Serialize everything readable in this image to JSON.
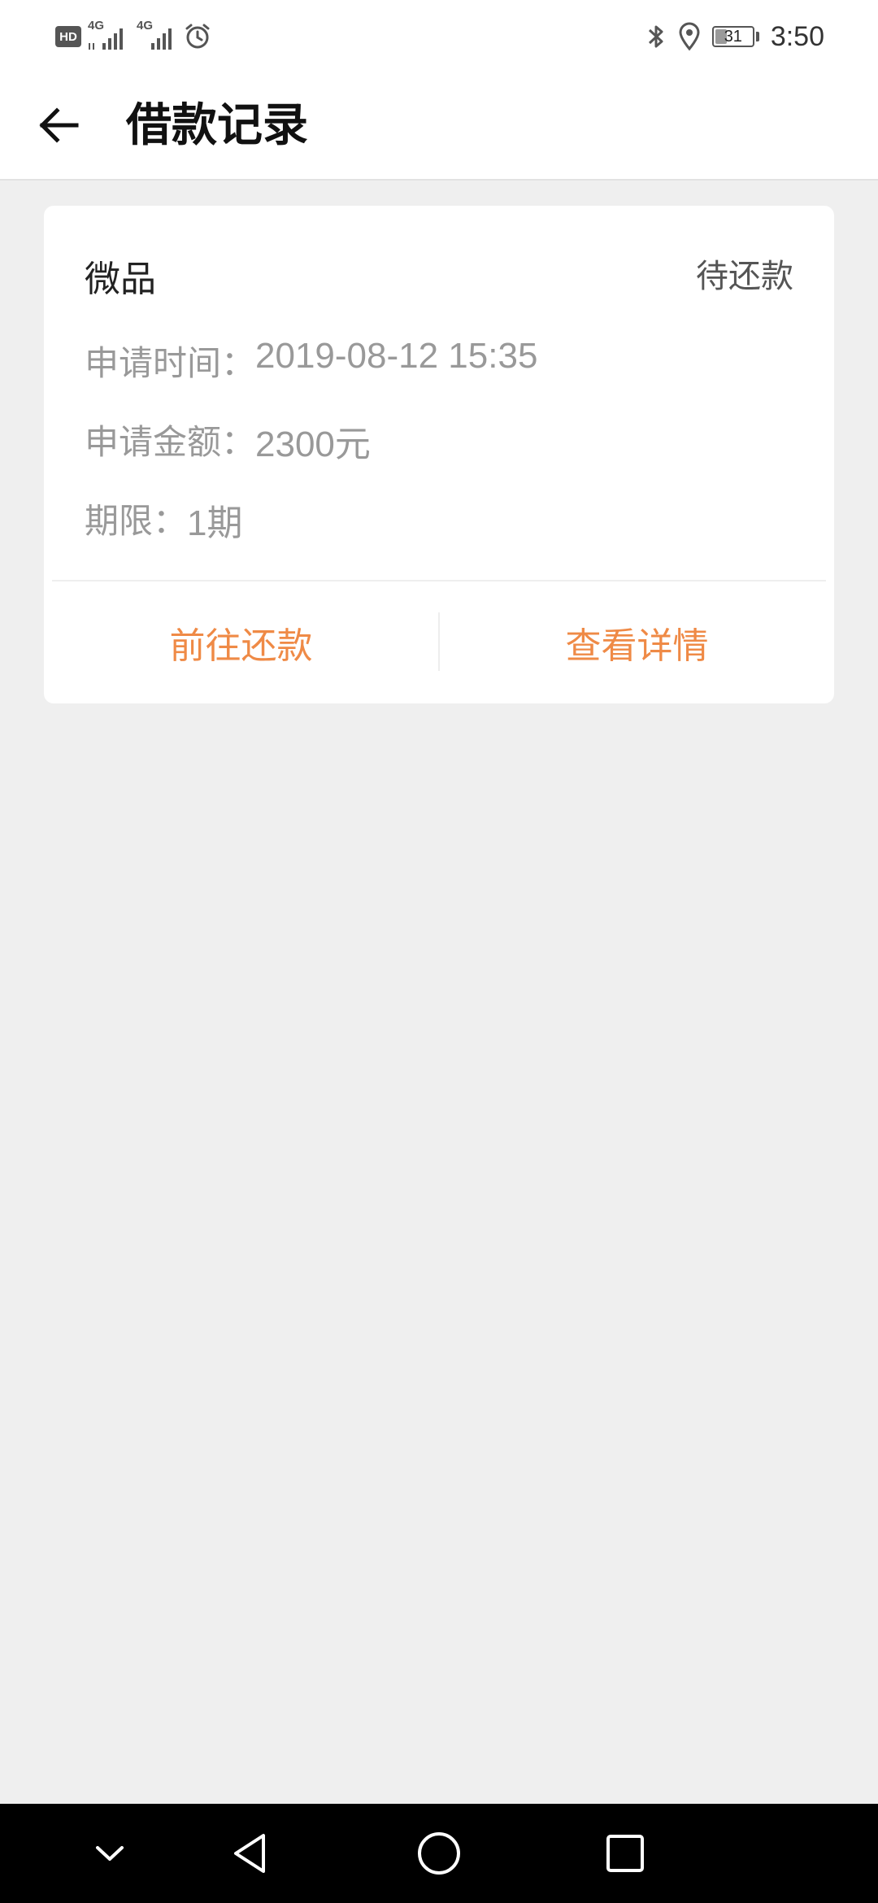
{
  "status_bar": {
    "hd_label": "HD",
    "sim1_network": "4G",
    "sim2_network": "4G",
    "battery_level": "31",
    "clock": "3:50"
  },
  "header": {
    "title": "借款记录"
  },
  "loan_card": {
    "product_name": "微品",
    "status": "待还款",
    "apply_time_label": "申请时间：",
    "apply_time_value": "2019-08-12 15:35",
    "apply_amount_label": "申请金额：",
    "apply_amount_value": "2300元",
    "term_label": "期限：",
    "term_value": "1期",
    "repay_button": "前往还款",
    "details_button": "查看详情",
    "accent_color": "#ef8a46"
  },
  "icons": {
    "back": "arrow-left-icon",
    "bluetooth": "bluetooth-icon",
    "location": "location-icon",
    "alarm": "alarm-icon",
    "nav_down": "chevron-down-icon",
    "nav_back": "triangle-back-icon",
    "nav_home": "circle-home-icon",
    "nav_recents": "square-recents-icon"
  }
}
